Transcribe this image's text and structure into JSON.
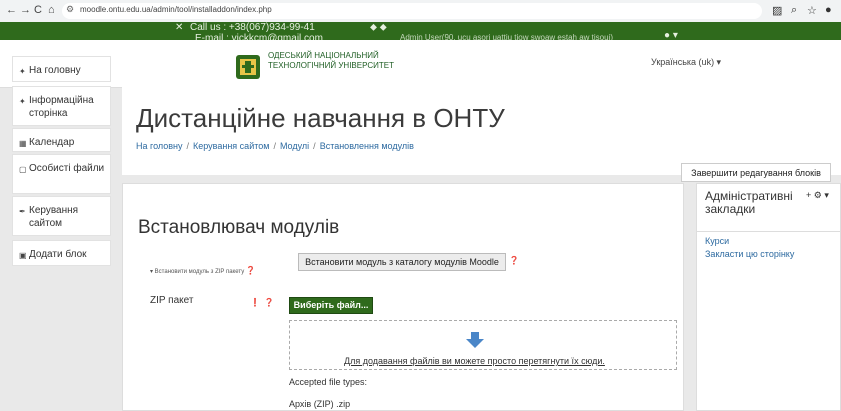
{
  "browser": {
    "url": "moodle.ontu.edu.ua/admin/tool/installaddon/index.php",
    "nav_back": "←",
    "nav_forward": "→",
    "nav_reload": "C",
    "nav_home": "⌂"
  },
  "topbar": {
    "phone": "Call us : +38(067)934-99-41",
    "email": "E-mail : vickkcm@gmail.com",
    "admin_text": "Admin User(90, ucu asori uattiu tiow swoaw estah aw tisoui)"
  },
  "header": {
    "university_line1": "Одеський національний",
    "university_line2": "технологічний університет",
    "language": "Українська (uk) ▾"
  },
  "nav": [
    {
      "icon": "home-icon",
      "glyph": "✦",
      "label": "На головну"
    },
    {
      "icon": "info-icon",
      "glyph": "✦",
      "label": "Інформаційна сторінка"
    },
    {
      "icon": "calendar-icon",
      "glyph": "▦",
      "label": "Календар"
    },
    {
      "icon": "file-icon",
      "glyph": "▢",
      "label": "Особисті файли"
    },
    {
      "icon": "wrench-icon",
      "glyph": "✒",
      "label": "Керування сайтом"
    },
    {
      "icon": "plus-square-icon",
      "glyph": "▣",
      "label": "Додати блок"
    }
  ],
  "page": {
    "title": "Дистанційне навчання в ОНТУ",
    "breadcrumb": [
      "На головну",
      "Керування сайтом",
      "Модулі",
      "Встановлення модулів"
    ],
    "edit_blocks_button": "Завершити редагування блоків",
    "heading": "Встановлювач модулів",
    "install_from_catalog_button": "Встановити модуль з каталогу модулів Moodle",
    "zip_legend": "▾ Встановити модуль з ZIP пакету",
    "zip_label": "ZIP пакет",
    "choose_file_button": "Виберіть файл...",
    "drop_text": "Для додавання файлів ви можете просто перетягнути їх сюди.",
    "accepted_types": "Accepted file types:",
    "archive_type": "Архів (ZIP) .zip"
  },
  "admin_block": {
    "title": "Адміністративні закладки",
    "controls": "+ ⚙ ▾",
    "links": [
      "Курси",
      "Закласти цю сторінку"
    ]
  },
  "colors": {
    "brand_green": "#2f6a1c",
    "link_blue": "#2d6aa0",
    "required_red": "#c0392b"
  }
}
